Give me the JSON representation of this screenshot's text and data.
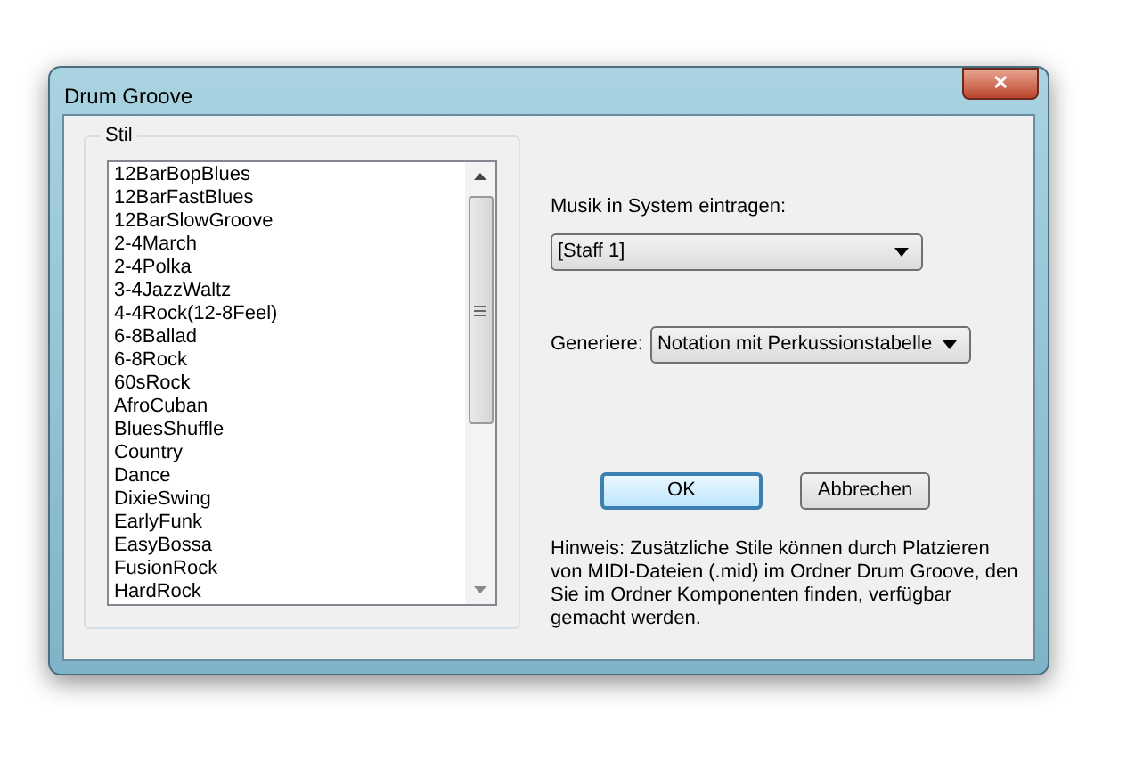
{
  "window": {
    "title": "Drum Groove",
    "close": "✕"
  },
  "style_group": {
    "label": "Stil",
    "items": [
      {
        "label": "12BarBopBlues",
        "selected": false
      },
      {
        "label": "12BarFastBlues",
        "selected": false
      },
      {
        "label": "12BarSlowGroove",
        "selected": false
      },
      {
        "label": "2-4March",
        "selected": false
      },
      {
        "label": "2-4Polka",
        "selected": false
      },
      {
        "label": "3-4JazzWaltz",
        "selected": false
      },
      {
        "label": "4-4Rock(12-8Feel)",
        "selected": false
      },
      {
        "label": "6-8Ballad",
        "selected": false
      },
      {
        "label": "6-8Rock",
        "selected": false
      },
      {
        "label": "60sRock",
        "selected": false
      },
      {
        "label": "AfroCuban",
        "selected": false
      },
      {
        "label": "BluesShuffle",
        "selected": false
      },
      {
        "label": "Country",
        "selected": false
      },
      {
        "label": "Dance",
        "selected": false
      },
      {
        "label": "DixieSwing",
        "selected": false
      },
      {
        "label": "EarlyFunk",
        "selected": false
      },
      {
        "label": "EasyBossa",
        "selected": false
      },
      {
        "label": "FusionRock",
        "selected": false
      },
      {
        "label": "HardRock",
        "selected": false
      }
    ]
  },
  "staff": {
    "label": "Musik in System eintragen:",
    "value": "[Staff 1]"
  },
  "generate": {
    "label": "Generiere:",
    "value": "Notation mit Perkussionstabelle"
  },
  "buttons": [
    {
      "label": "OK",
      "default": true
    },
    {
      "label": "Abbrechen",
      "default": false
    }
  ],
  "note": "Hinweis: Zusätzliche Stile können durch Platzieren von MIDI-Dateien (.mid) im Ordner Drum Groove, den Sie im Ordner Komponenten finden, verfügbar gemacht werden."
}
